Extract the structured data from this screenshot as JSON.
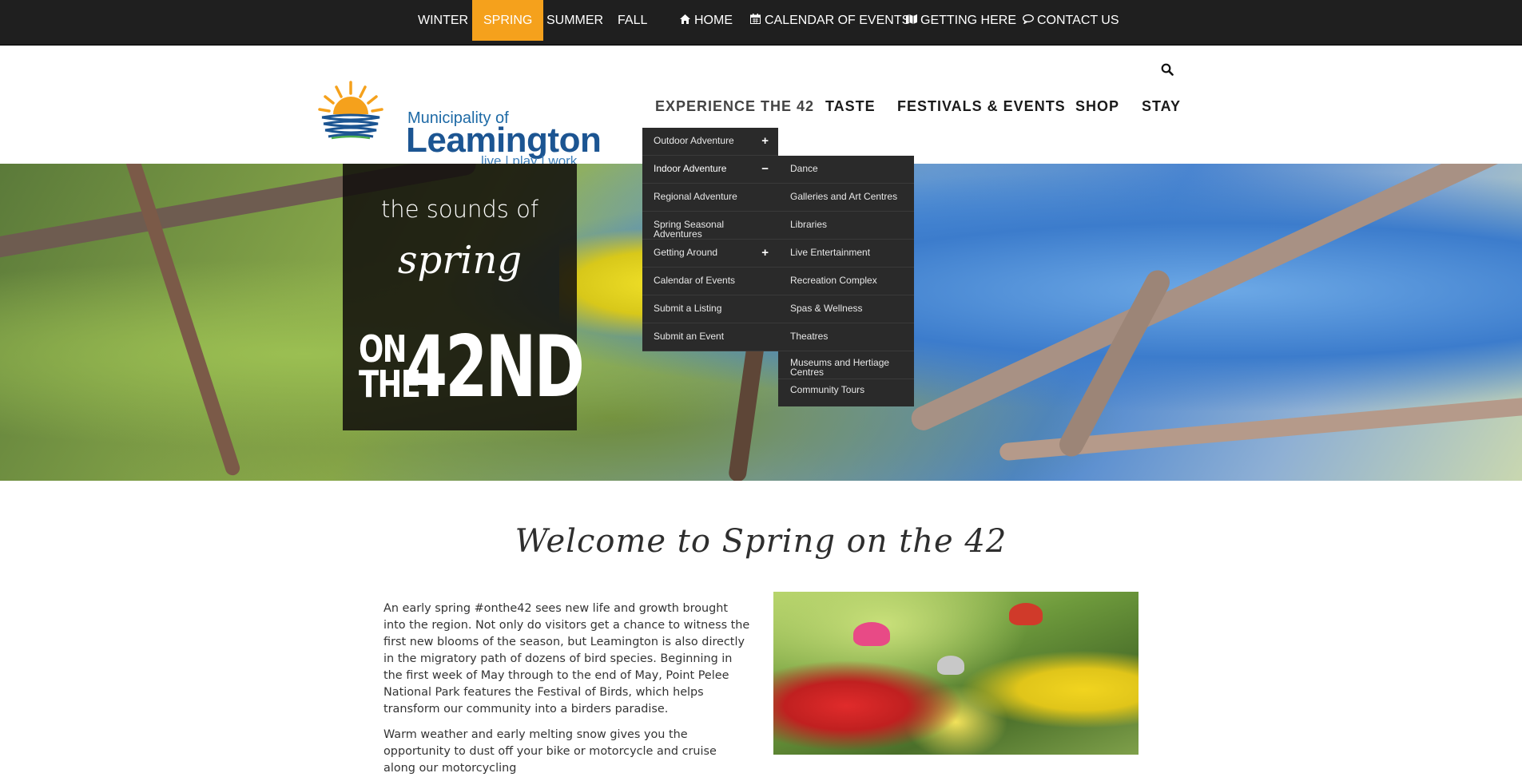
{
  "topbar": {
    "seasons": [
      "WINTER",
      "SPRING",
      "SUMMER",
      "FALL"
    ],
    "active_season": "SPRING",
    "links": [
      {
        "label": "HOME",
        "icon": "home-icon"
      },
      {
        "label": "CALENDAR OF EVENTS",
        "icon": "calendar-icon"
      },
      {
        "label": "GETTING HERE",
        "icon": "map-icon"
      },
      {
        "label": "CONTACT US",
        "icon": "comment-icon"
      }
    ],
    "active_color": "#f5a11c"
  },
  "logo": {
    "municipality": "Municipality of",
    "name": "Leamington",
    "tagline": "live | play | work"
  },
  "main_nav": [
    "EXPERIENCE THE 42",
    "TASTE",
    "FESTIVALS & EVENTS",
    "SHOP",
    "STAY"
  ],
  "dropdown": {
    "items": [
      {
        "label": "Outdoor Adventure",
        "sign": "+"
      },
      {
        "label": "Indoor Adventure",
        "sign": "−"
      },
      {
        "label": "Regional Adventure",
        "sign": ""
      },
      {
        "label": "Spring Seasonal Adventures",
        "sign": ""
      },
      {
        "label": "Getting Around",
        "sign": "+"
      },
      {
        "label": "Calendar of Events",
        "sign": ""
      },
      {
        "label": "Submit a Listing",
        "sign": ""
      },
      {
        "label": "Submit an Event",
        "sign": ""
      }
    ],
    "submenu": [
      "Dance",
      "Galleries and Art Centres",
      "Libraries",
      "Live Entertainment",
      "Recreation Complex",
      "Spas & Wellness",
      "Theatres",
      "Museums and Hertiage Centres",
      "Community Tours"
    ]
  },
  "hero": {
    "line1": "the sounds of",
    "line2": "spring",
    "on": "ON",
    "the": "THE",
    "number": "42ND"
  },
  "welcome": {
    "title": "Welcome to Spring on the 42",
    "paragraphs": [
      "An early spring #onthe42 sees new life and growth brought into the region. Not only do visitors get a chance to witness the first new blooms of the season, but Leamington is also directly in the migratory path of dozens of bird species. Beginning in the first week of May through to the end of May, Point Pelee National Park features the Festival of Birds, which helps transform our community into a birders paradise.",
      "Warm weather and early melting snow gives you the opportunity to dust off your bike or motorcycle and cruise along our motorcycling"
    ]
  }
}
